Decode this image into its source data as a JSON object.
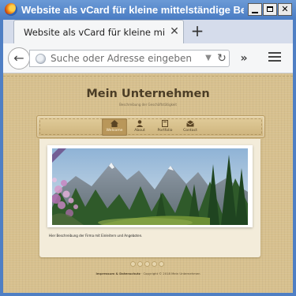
{
  "window": {
    "title": "Website als vCard für kleine mittelständige Betrie..."
  },
  "tabs": [
    {
      "label": "Website als vCard für kleine mittel...",
      "active": true
    }
  ],
  "navbar": {
    "url_placeholder": "Suche oder Adresse eingeben",
    "icons": [
      "back-arrow-icon",
      "globe-icon",
      "dropdown-icon",
      "reload-icon",
      "overflow-icon",
      "menu-icon"
    ]
  },
  "site": {
    "title": "Mein Unternehmen",
    "subtitle": "Beschreibung der Geschäftstätigkeit",
    "menu": [
      {
        "label": "Welcome",
        "icon": "home-icon",
        "active": true
      },
      {
        "label": "About",
        "icon": "person-icon",
        "active": false
      },
      {
        "label": "Portfolio",
        "icon": "folder-icon",
        "active": false
      },
      {
        "label": "Contact",
        "icon": "mail-icon",
        "active": false
      }
    ],
    "description": "Hier Beschreibung der Firma mit Einleitern und Angeboten.",
    "footer": {
      "links": "Impressum & Datenschutz",
      "separator": " · ",
      "copyright": "Copyright © 2018 Mein Unternehmen"
    },
    "pagination_count": 5,
    "colors": {
      "background": "#d7c08e",
      "panel": "#f3ecda",
      "menu": "#cdb37b",
      "active_menu": "#b9975a",
      "title_text": "#4b3d26"
    }
  }
}
